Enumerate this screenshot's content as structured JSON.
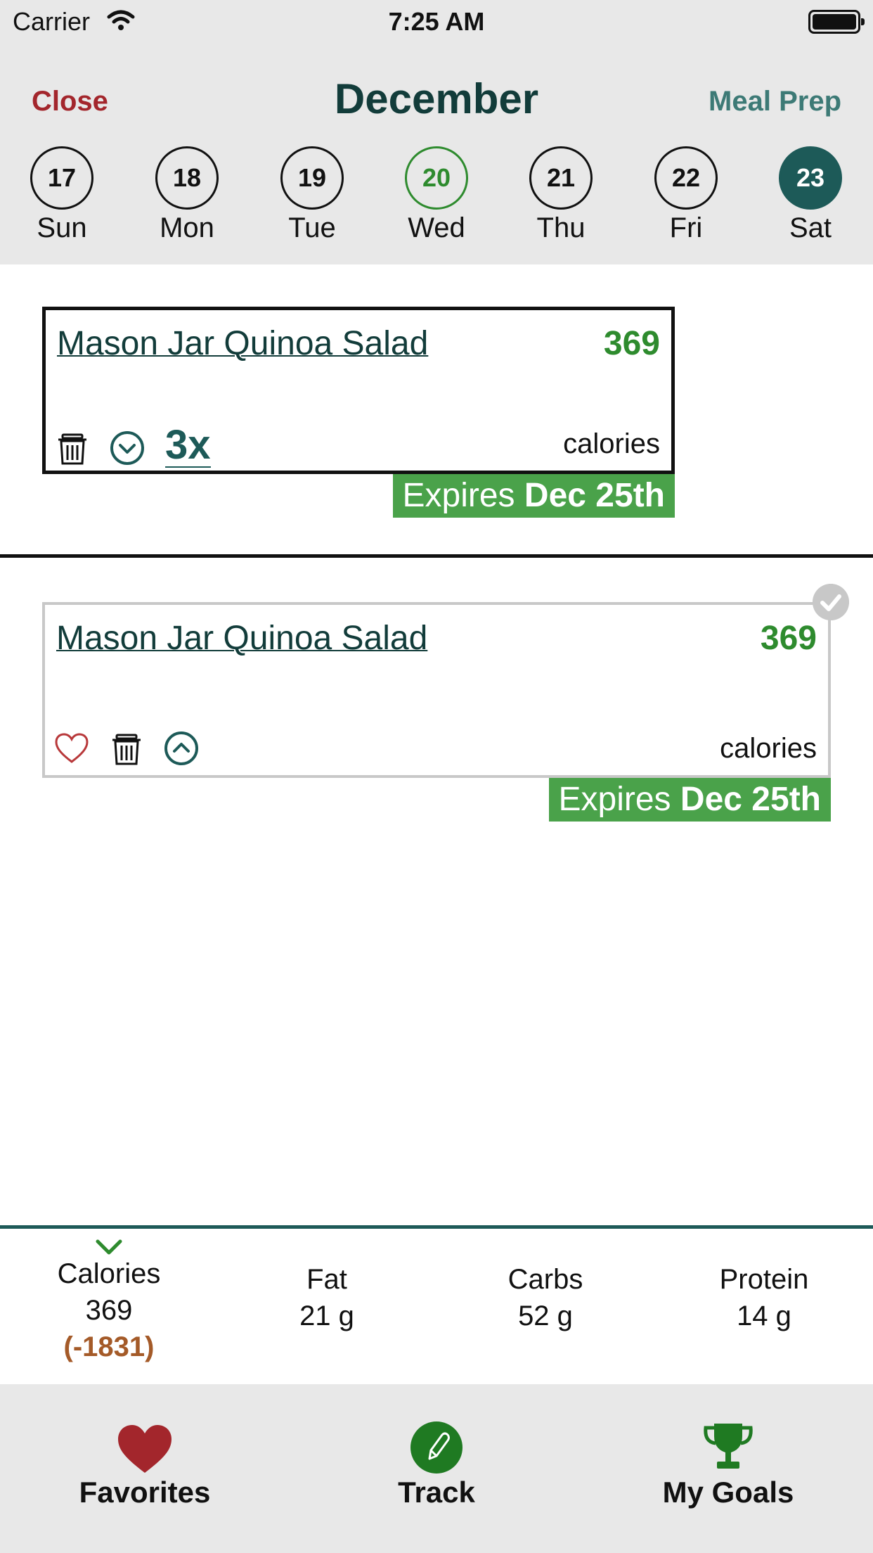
{
  "status_bar": {
    "carrier": "Carrier",
    "time": "7:25 AM"
  },
  "header": {
    "close_label": "Close",
    "title": "December",
    "meal_prep_label": "Meal Prep",
    "days": [
      {
        "num": "17",
        "name": "Sun"
      },
      {
        "num": "18",
        "name": "Mon"
      },
      {
        "num": "19",
        "name": "Tue"
      },
      {
        "num": "20",
        "name": "Wed",
        "state": "today"
      },
      {
        "num": "21",
        "name": "Thu"
      },
      {
        "num": "22",
        "name": "Fri"
      },
      {
        "num": "23",
        "name": "Sat",
        "state": "selected"
      }
    ]
  },
  "meals": [
    {
      "name": "Mason Jar Quinoa Salad",
      "calories": "369",
      "calories_label": "calories",
      "servings": "3x",
      "expires_prefix": "Expires",
      "expires_date": "Dec 25th"
    },
    {
      "name": "Mason Jar Quinoa Salad",
      "calories": "369",
      "calories_label": "calories",
      "expires_prefix": "Expires",
      "expires_date": "Dec 25th"
    }
  ],
  "summary": {
    "calories": {
      "label": "Calories",
      "value": "369",
      "deficit": "(-1831)"
    },
    "fat": {
      "label": "Fat",
      "value": "21 g"
    },
    "carbs": {
      "label": "Carbs",
      "value": "52 g"
    },
    "protein": {
      "label": "Protein",
      "value": "14 g"
    }
  },
  "tabbar": {
    "favorites_label": "Favorites",
    "track_label": "Track",
    "goals_label": "My Goals"
  },
  "colors": {
    "brand_dark_teal": "#1d5a58",
    "title_teal": "#123c3a",
    "accent_green": "#2e8b2e",
    "expires_green": "#4aa24a",
    "close_red": "#a3262c",
    "deficit_brown": "#a45a28",
    "header_gray": "#e8e8e8"
  },
  "icons": [
    "wifi-icon",
    "battery-icon",
    "trash-icon",
    "chevron-down-circle-icon",
    "chevron-up-circle-icon",
    "heart-outline-icon",
    "checkmark-badge-icon",
    "chevron-down-icon",
    "heart-icon",
    "pencil-icon",
    "trophy-icon"
  ]
}
